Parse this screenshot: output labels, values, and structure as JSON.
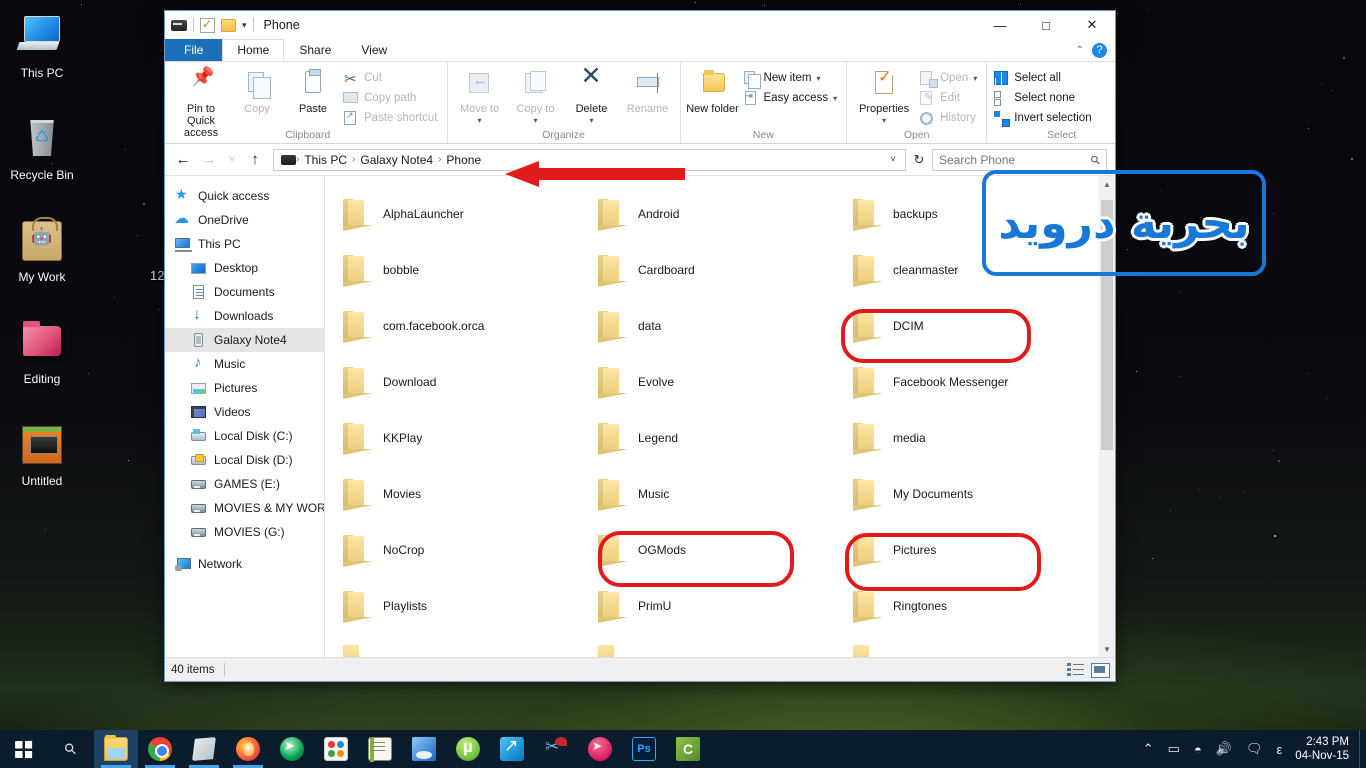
{
  "desktop": {
    "clock_overlay": "12",
    "icons": [
      {
        "label": "This PC",
        "icon": "this-pc-icon"
      },
      {
        "label": "Recycle Bin",
        "icon": "recycle-bin-icon"
      },
      {
        "label": "My Work",
        "icon": "my-work-folder-icon"
      },
      {
        "label": "Editing",
        "icon": "editing-folder-icon"
      },
      {
        "label": "Untitled",
        "icon": "untitled-video-icon"
      }
    ]
  },
  "window": {
    "title": "Phone",
    "quick_access": {
      "pc_icon": "computer-icon",
      "properties_icon": "properties-icon",
      "new_folder_icon": "new-folder-icon",
      "customize_caret": "▾"
    },
    "controls": {
      "minimize": "—",
      "maximize": "□",
      "close": "✕"
    },
    "tabs": [
      {
        "label": "File",
        "kind": "file"
      },
      {
        "label": "Home",
        "kind": "active"
      },
      {
        "label": "Share",
        "kind": "normal"
      },
      {
        "label": "View",
        "kind": "normal"
      }
    ],
    "ribbon_collapse_icon": "⌃",
    "help_icon": "?"
  },
  "ribbon": {
    "groups": [
      {
        "name": "Clipboard",
        "big_buttons": [
          {
            "label": "Pin to Quick access",
            "icon": "pin-icon",
            "dim": false
          },
          {
            "label": "Copy",
            "icon": "copy-icon",
            "dim": true
          },
          {
            "label": "Paste",
            "icon": "paste-icon",
            "dim": false
          }
        ],
        "small_buttons": [
          {
            "label": "Cut",
            "icon": "scissors-icon",
            "dim": true
          },
          {
            "label": "Copy path",
            "icon": "copy-path-icon",
            "dim": true
          },
          {
            "label": "Paste shortcut",
            "icon": "paste-shortcut-icon",
            "dim": true
          }
        ]
      },
      {
        "name": "Organize",
        "big_buttons": [
          {
            "label": "Move to",
            "icon": "move-to-icon",
            "dim": true,
            "caret": "▾"
          },
          {
            "label": "Copy to",
            "icon": "copy-to-icon",
            "dim": true,
            "caret": "▾"
          },
          {
            "label": "Delete",
            "icon": "delete-icon",
            "dim": false,
            "caret": "▾"
          },
          {
            "label": "Rename",
            "icon": "rename-icon",
            "dim": true
          }
        ],
        "small_buttons": []
      },
      {
        "name": "New",
        "big_buttons": [
          {
            "label": "New folder",
            "icon": "new-folder-icon",
            "dim": false
          }
        ],
        "small_buttons": [
          {
            "label": "New item",
            "icon": "new-item-icon",
            "dim": false,
            "caret": "▾"
          },
          {
            "label": "Easy access",
            "icon": "easy-access-icon",
            "dim": false,
            "caret": "▾"
          }
        ]
      },
      {
        "name": "Open",
        "big_buttons": [
          {
            "label": "Properties",
            "icon": "properties-icon",
            "dim": false,
            "caret": "▾"
          }
        ],
        "small_buttons": [
          {
            "label": "Open",
            "icon": "open-icon",
            "dim": true,
            "caret": "▾"
          },
          {
            "label": "Edit",
            "icon": "edit-icon",
            "dim": true
          },
          {
            "label": "History",
            "icon": "history-icon",
            "dim": true
          }
        ]
      },
      {
        "name": "Select",
        "big_buttons": [],
        "small_buttons": [
          {
            "label": "Select all",
            "icon": "select-all-icon",
            "dim": false
          },
          {
            "label": "Select none",
            "icon": "select-none-icon",
            "dim": false
          },
          {
            "label": "Invert selection",
            "icon": "invert-selection-icon",
            "dim": false
          }
        ]
      }
    ]
  },
  "address_bar": {
    "back_icon": "←",
    "forward_icon": "→",
    "recent_icon": "˅",
    "up_icon": "↑",
    "breadcrumbs": [
      "This PC",
      "Galaxy Note4",
      "Phone"
    ],
    "separator": "›",
    "dropdown_icon": "˅",
    "refresh_icon": "↻",
    "search": {
      "placeholder": "Search Phone",
      "value": "",
      "icon": "search-icon"
    }
  },
  "nav_pane": {
    "items": [
      {
        "label": "Quick access",
        "icon": "star-icon",
        "indent": false,
        "selected": false
      },
      {
        "label": "OneDrive",
        "icon": "cloud-icon",
        "indent": false,
        "selected": false
      },
      {
        "label": "This PC",
        "icon": "this-pc-icon",
        "indent": false,
        "selected": false
      },
      {
        "label": "Desktop",
        "icon": "desktop-icon",
        "indent": true,
        "selected": false
      },
      {
        "label": "Documents",
        "icon": "documents-icon",
        "indent": true,
        "selected": false
      },
      {
        "label": "Downloads",
        "icon": "downloads-icon",
        "indent": true,
        "selected": false
      },
      {
        "label": "Galaxy Note4",
        "icon": "phone-icon",
        "indent": true,
        "selected": true
      },
      {
        "label": "Music",
        "icon": "music-icon",
        "indent": true,
        "selected": false
      },
      {
        "label": "Pictures",
        "icon": "pictures-icon",
        "indent": true,
        "selected": false
      },
      {
        "label": "Videos",
        "icon": "videos-icon",
        "indent": true,
        "selected": false
      },
      {
        "label": "Local Disk (C:)",
        "icon": "disk-c-icon",
        "indent": true,
        "selected": false
      },
      {
        "label": "Local Disk (D:)",
        "icon": "disk-d-icon",
        "indent": true,
        "selected": false
      },
      {
        "label": "GAMES (E:)",
        "icon": "disk-icon",
        "indent": true,
        "selected": false
      },
      {
        "label": "MOVIES & MY WOR",
        "icon": "disk-icon",
        "indent": true,
        "selected": false
      },
      {
        "label": "MOVIES (G:)",
        "icon": "disk-icon",
        "indent": true,
        "selected": false
      },
      {
        "label": "Network",
        "icon": "network-icon",
        "indent": false,
        "selected": false
      }
    ]
  },
  "files": {
    "items": [
      {
        "name": "AlphaLauncher",
        "type": "folder"
      },
      {
        "name": "bobble",
        "type": "folder"
      },
      {
        "name": "com.facebook.orca",
        "type": "folder"
      },
      {
        "name": "Download",
        "type": "folder"
      },
      {
        "name": "KKPlay",
        "type": "folder"
      },
      {
        "name": "Movies",
        "type": "folder"
      },
      {
        "name": "NoCrop",
        "type": "folder"
      },
      {
        "name": "Playlists",
        "type": "folder"
      },
      {
        "name": "Android",
        "type": "folder"
      },
      {
        "name": "Cardboard",
        "type": "folder"
      },
      {
        "name": "data",
        "type": "folder"
      },
      {
        "name": "Evolve",
        "type": "folder"
      },
      {
        "name": "Legend",
        "type": "folder"
      },
      {
        "name": "Music",
        "type": "folder"
      },
      {
        "name": "OGMods",
        "type": "folder"
      },
      {
        "name": "PrimU",
        "type": "folder"
      },
      {
        "name": "backups",
        "type": "folder"
      },
      {
        "name": "cleanmaster",
        "type": "folder"
      },
      {
        "name": "DCIM",
        "type": "folder"
      },
      {
        "name": "Facebook Messenger",
        "type": "folder"
      },
      {
        "name": "media",
        "type": "folder"
      },
      {
        "name": "My Documents",
        "type": "folder"
      },
      {
        "name": "Pictures",
        "type": "folder"
      },
      {
        "name": "Ringtones",
        "type": "folder"
      }
    ]
  },
  "status_bar": {
    "item_count": "40 items",
    "details_view_icon": "details-view-icon",
    "large_icons_view_icon": "large-icons-view-icon"
  },
  "annotations": {
    "highlighted_folders": [
      "DCIM",
      "OGMods",
      "Pictures"
    ],
    "arrow_target": "breadcrumb",
    "watermark_text": "بحرية درويد",
    "highlight_color": "#e01b1b",
    "watermark_color": "#1878d8"
  },
  "taskbar": {
    "start_icon": "windows-start-icon",
    "search_icon": "search-icon",
    "apps": [
      {
        "icon": "file-explorer-icon",
        "active": true
      },
      {
        "icon": "chrome-icon",
        "active": false
      },
      {
        "icon": "store-icon",
        "active": false
      },
      {
        "icon": "firefox-icon",
        "active": false
      },
      {
        "icon": "green-arrow-icon",
        "active": false
      },
      {
        "icon": "color-palette-icon",
        "active": false
      },
      {
        "icon": "notepad-icon",
        "active": false
      },
      {
        "icon": "remote-desktop-icon",
        "active": false
      },
      {
        "icon": "utorrent-icon",
        "active": false
      },
      {
        "icon": "idm-icon",
        "active": false
      },
      {
        "icon": "snipping-tool-icon",
        "active": false
      },
      {
        "icon": "pink-app-icon",
        "active": false
      },
      {
        "icon": "photoshop-icon",
        "label": "Ps",
        "active": false
      },
      {
        "icon": "camtasia-icon",
        "label": "C",
        "active": false
      }
    ],
    "tray": [
      {
        "icon": "chevron-up-icon",
        "glyph": "⌃"
      },
      {
        "icon": "battery-icon",
        "glyph": "▭"
      },
      {
        "icon": "wifi-icon",
        "glyph": "◠"
      },
      {
        "icon": "volume-icon",
        "glyph": "ὐA"
      },
      {
        "icon": "action-center-icon",
        "glyph": "⌸"
      },
      {
        "icon": "language-indicator",
        "glyph": "ε"
      }
    ],
    "clock": {
      "time": "2:43 PM",
      "date": "04-Nov-15"
    }
  }
}
